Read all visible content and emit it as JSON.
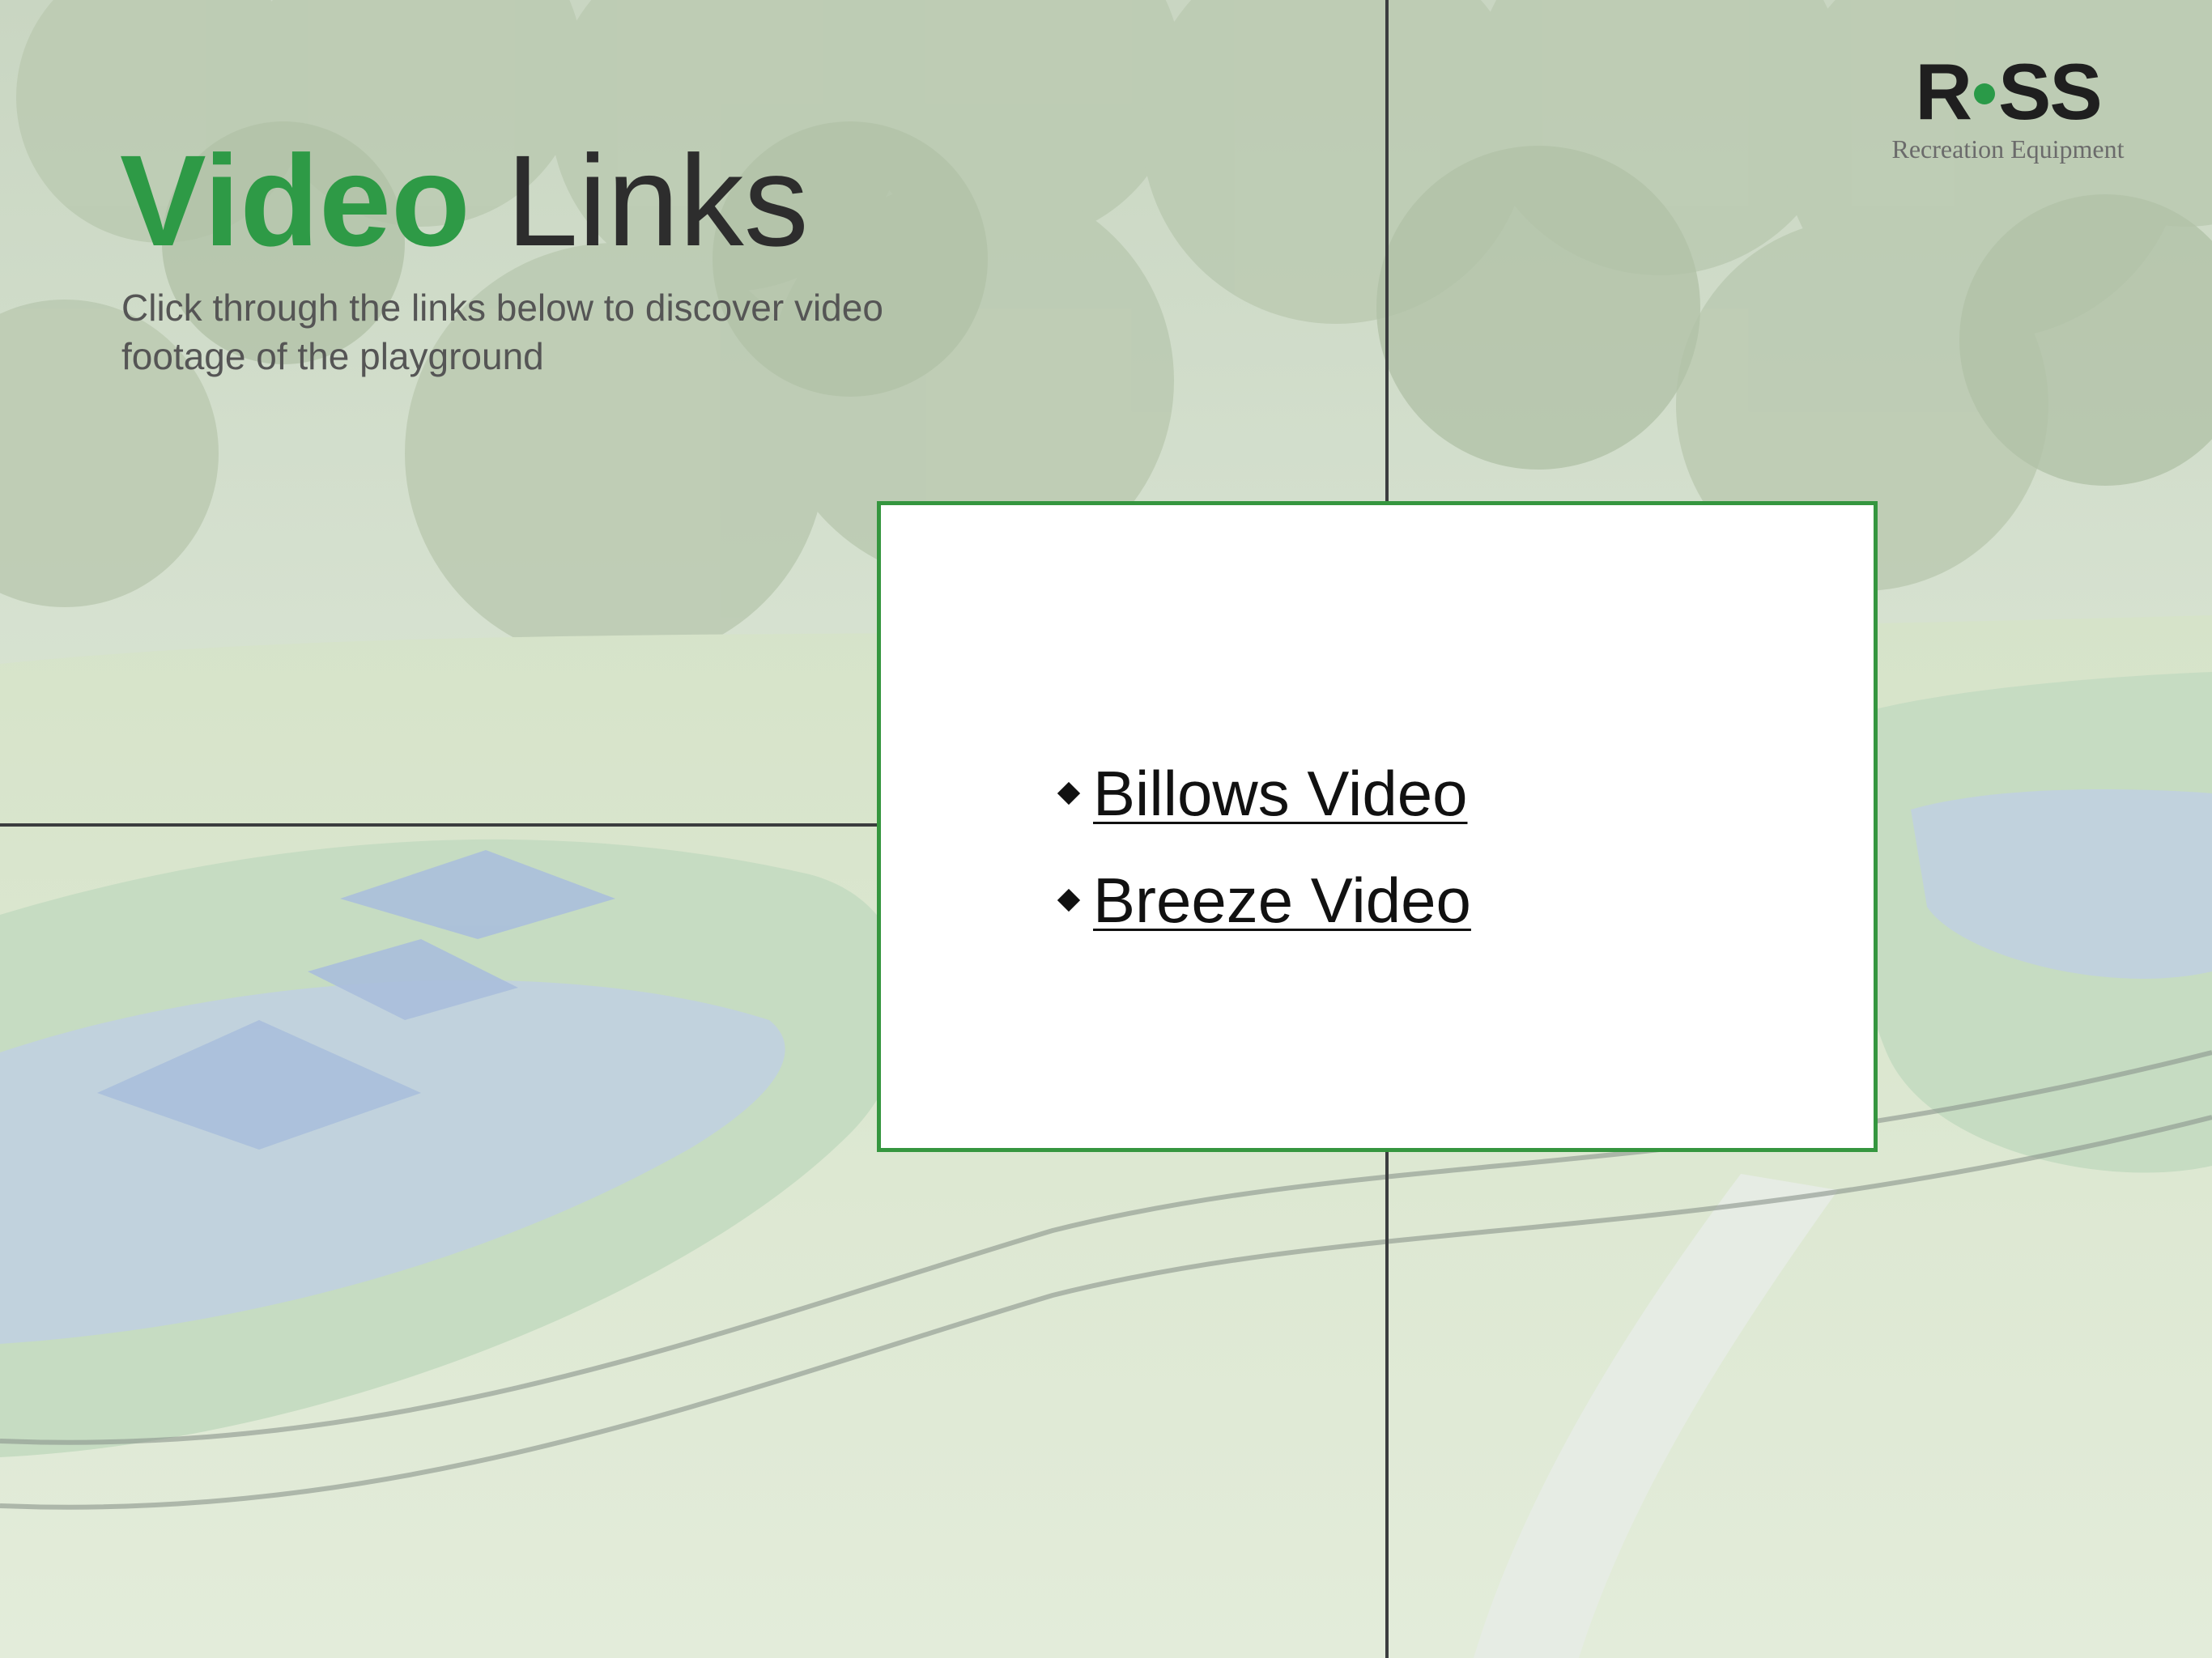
{
  "slide": {
    "title_bold": "Video",
    "title_light": "Links",
    "subtitle": "Click through the links below to discover video footage of the playground"
  },
  "logo": {
    "word_left": "R",
    "word_right": "SS",
    "tagline": "Recreation Equipment",
    "dot_color": "#2a9a48"
  },
  "links": [
    {
      "label": "Billows Video",
      "bullet_icon": "diamond-bullet-icon"
    },
    {
      "label": "Breeze Video",
      "bullet_icon": "diamond-bullet-icon"
    }
  ],
  "colors": {
    "accent_green": "#2e9a46",
    "card_border": "#35963f",
    "text_dark": "#2d2d2d",
    "grid_line": "#3b3d3f"
  },
  "background": {
    "icon": "playground-aerial-image"
  }
}
